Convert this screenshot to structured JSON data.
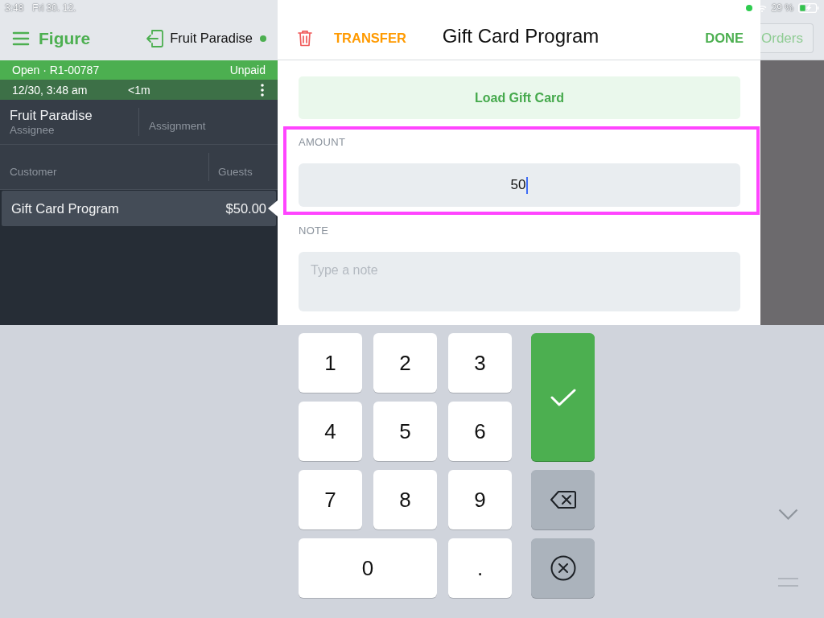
{
  "status_bar": {
    "time": "3:48",
    "date": "Fri 30. 12.",
    "battery": "29 %"
  },
  "sidebar": {
    "app_title": "Figure",
    "location": {
      "name": "Fruit Paradise",
      "online": true
    },
    "order": {
      "status": "Open · R1-00787",
      "payment": "Unpaid",
      "created": "12/30, 3:48 am",
      "elapsed": "<1m"
    },
    "assignee": {
      "name": "Fruit Paradise",
      "label": "Assignee"
    },
    "assignment": {
      "label": "Assignment"
    },
    "customer": {
      "label": "Customer"
    },
    "guests": {
      "label": "Guests"
    },
    "items": [
      {
        "name": "Gift Card Program",
        "price": "$50.00",
        "selected": true
      }
    ]
  },
  "modal": {
    "transfer": "TRANSFER",
    "title": "Gift Card Program",
    "done": "DONE",
    "load_button": "Load Gift Card",
    "fields": [
      {
        "kind": "amount",
        "label": "AMOUNT",
        "value": "50",
        "focused": true,
        "highlighted": true
      },
      {
        "kind": "note",
        "label": "NOTE",
        "placeholder": "Type a note"
      }
    ]
  },
  "orders_button": "Orders",
  "keypad": [
    {
      "kind": "digit",
      "label": "1",
      "wide": false
    },
    {
      "kind": "digit",
      "label": "2",
      "wide": false
    },
    {
      "kind": "digit",
      "label": "3",
      "wide": false
    },
    {
      "kind": "confirm",
      "wide": false
    },
    {
      "kind": "digit",
      "label": "4",
      "wide": false
    },
    {
      "kind": "digit",
      "label": "5",
      "wide": false
    },
    {
      "kind": "digit",
      "label": "6",
      "wide": false
    },
    {
      "kind": "digit",
      "label": "7",
      "wide": false
    },
    {
      "kind": "digit",
      "label": "8",
      "wide": false
    },
    {
      "kind": "digit",
      "label": "9",
      "wide": false
    },
    {
      "kind": "backspace",
      "wide": false
    },
    {
      "kind": "digit",
      "label": "0",
      "wide": true
    },
    {
      "kind": "digit",
      "label": ".",
      "wide": false
    },
    {
      "kind": "clear",
      "wide": false
    }
  ]
}
